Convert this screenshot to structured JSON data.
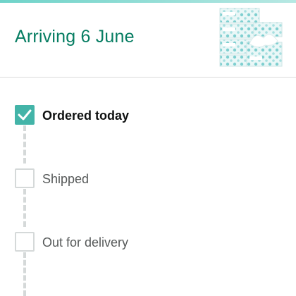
{
  "header": {
    "arrival_text": "Arriving 6 June",
    "product_image": "tissue-box-pack"
  },
  "colors": {
    "accent_teal": "#067d62",
    "check_teal": "#43b4a8",
    "pending_gray": "#d5d9d9"
  },
  "steps": [
    {
      "label": "Ordered today",
      "status": "completed",
      "icon": "checkmark-icon"
    },
    {
      "label": "Shipped",
      "status": "pending",
      "icon": "empty-checkbox-icon"
    },
    {
      "label": "Out for delivery",
      "status": "pending",
      "icon": "empty-checkbox-icon"
    }
  ]
}
